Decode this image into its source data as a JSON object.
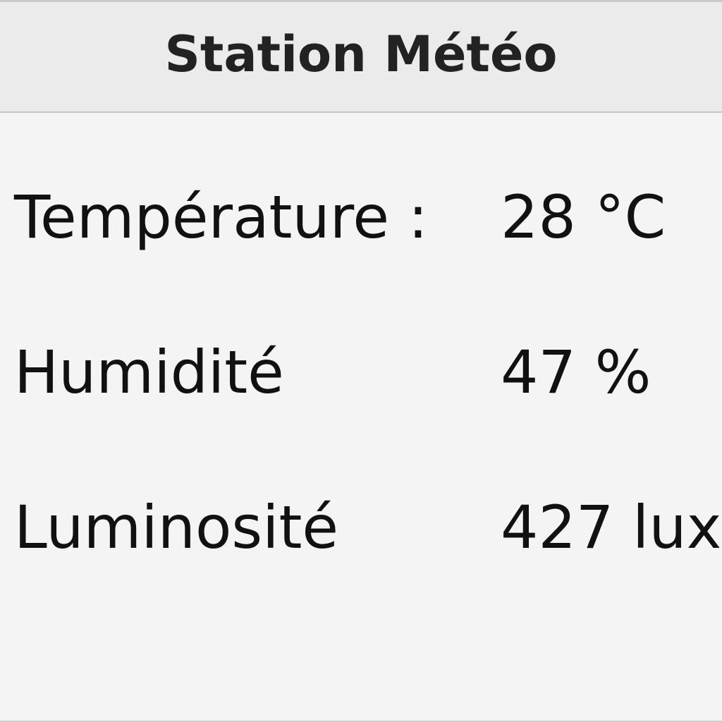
{
  "app": {
    "title": "Station Météo"
  },
  "readings": [
    {
      "label": "Température :",
      "value": "28 °C"
    },
    {
      "label": "Humidité",
      "value": "47 %"
    },
    {
      "label": "Luminosité",
      "value": "427 lux"
    }
  ],
  "colors": {
    "header_background": "#ebebeb",
    "page_background": "#f4f4f4",
    "text": "#111111"
  }
}
